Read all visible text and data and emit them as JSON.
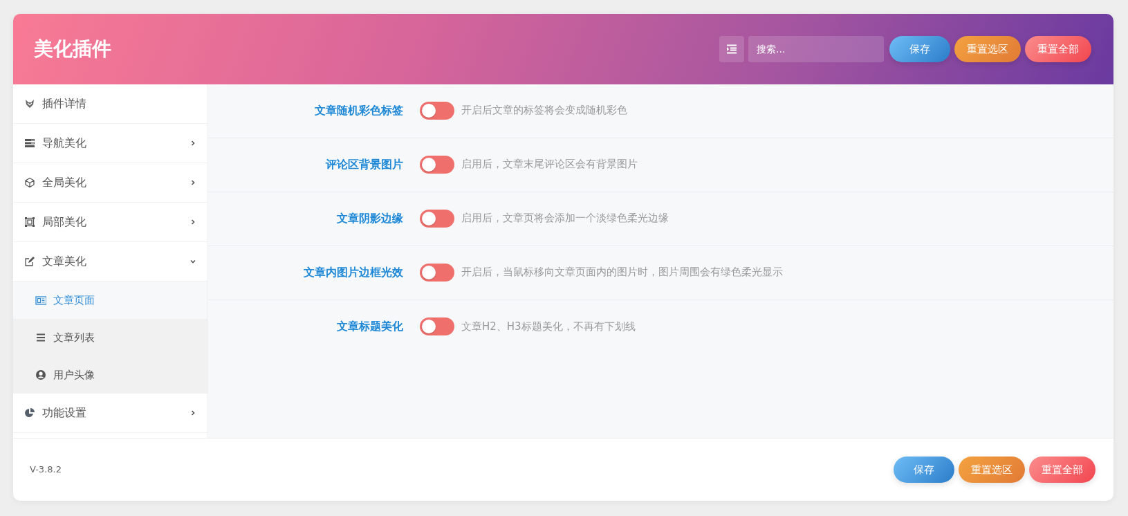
{
  "header": {
    "title": "美化插件",
    "search": {
      "placeholder": "搜索..."
    },
    "buttons": [
      {
        "label": "保存",
        "kind": "save"
      },
      {
        "label": "重置选区",
        "kind": "reset-section"
      },
      {
        "label": "重置全部",
        "kind": "reset-all"
      }
    ]
  },
  "sidebar": {
    "items": [
      {
        "label": "插件详情",
        "kind": "link"
      },
      {
        "label": "导航美化",
        "kind": "group",
        "expanded": false
      },
      {
        "label": "全局美化",
        "kind": "group",
        "expanded": false
      },
      {
        "label": "局部美化",
        "kind": "group",
        "expanded": false
      },
      {
        "label": "文章美化",
        "kind": "group",
        "expanded": true,
        "children": [
          {
            "label": "文章页面",
            "selected": true
          },
          {
            "label": "文章列表",
            "selected": false
          },
          {
            "label": "用户头像",
            "selected": false
          }
        ]
      },
      {
        "label": "功能设置",
        "kind": "group",
        "expanded": false
      }
    ]
  },
  "settings": [
    {
      "label": "文章随机彩色标签",
      "on": false,
      "description": "开启后文章的标签将会变成随机彩色"
    },
    {
      "label": "评论区背景图片",
      "on": false,
      "description": "启用后，文章末尾评论区会有背景图片"
    },
    {
      "label": "文章阴影边缘",
      "on": false,
      "description": "启用后，文章页将会添加一个淡绿色柔光边缘"
    },
    {
      "label": "文章内图片边框光效",
      "on": false,
      "description": "开启后，当鼠标移向文章页面内的图片时，图片周围会有绿色柔光显示"
    },
    {
      "label": "文章标题美化",
      "on": false,
      "description": "文章H2、H3标题美化，不再有下划线"
    }
  ],
  "footer": {
    "version": "V-3.8.2",
    "buttons": [
      {
        "label": "保存",
        "kind": "save"
      },
      {
        "label": "重置选区",
        "kind": "reset-section"
      },
      {
        "label": "重置全部",
        "kind": "reset-all"
      }
    ]
  }
}
